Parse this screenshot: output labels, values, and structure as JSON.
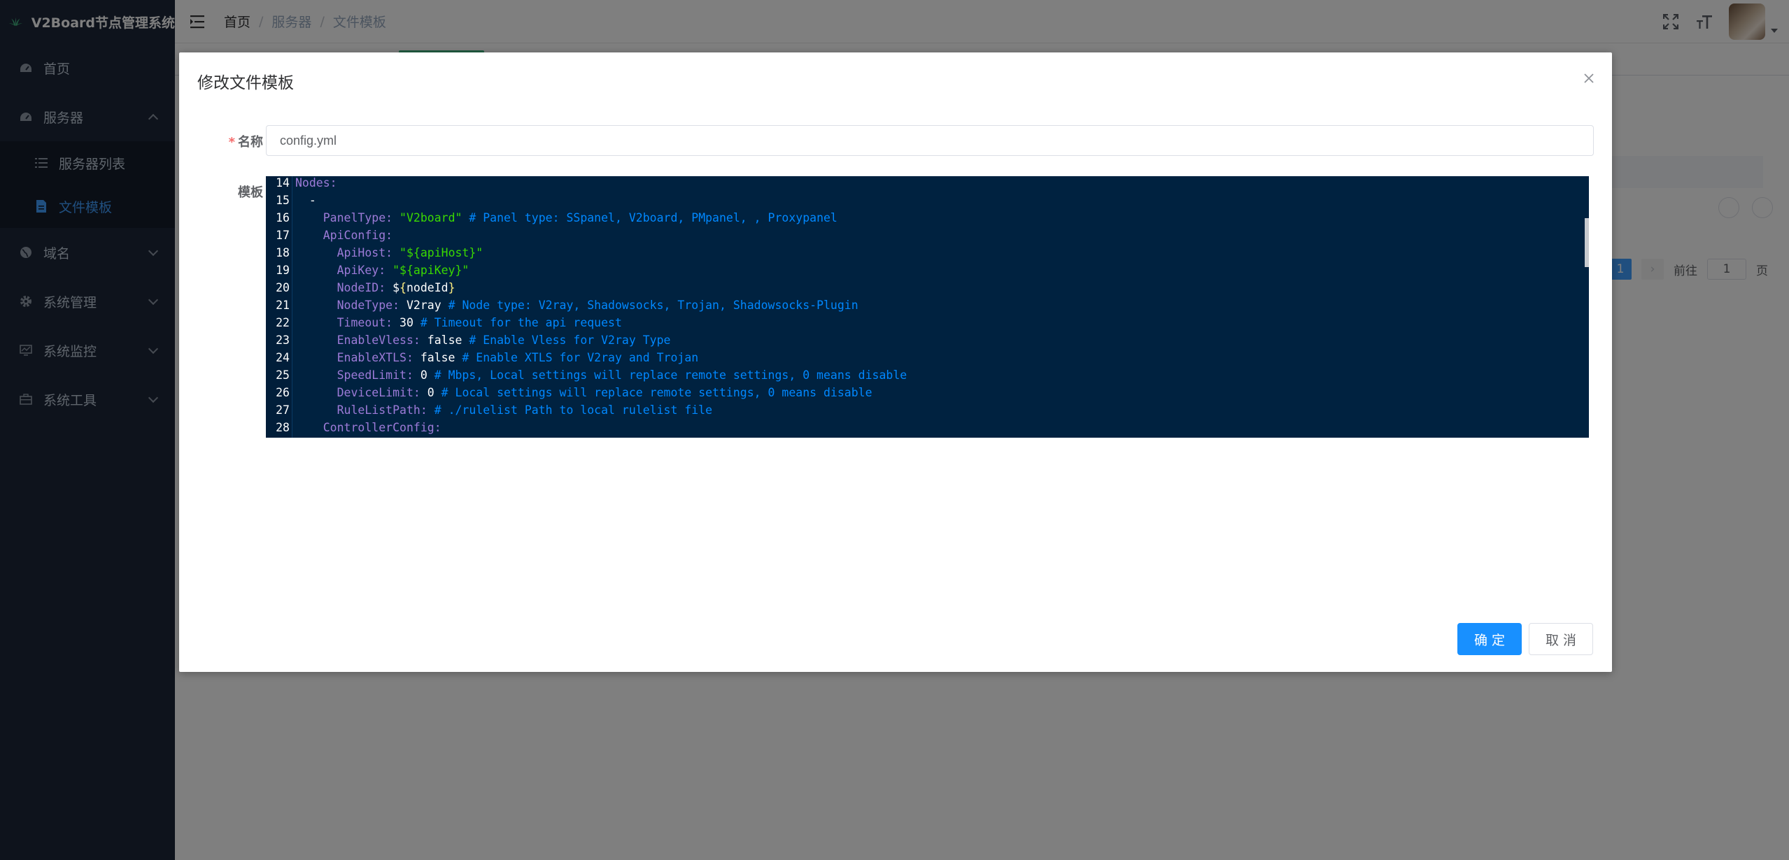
{
  "app": {
    "title": "V2Board节点管理系统"
  },
  "sidebar": {
    "items": [
      {
        "label": "首页",
        "icon": "dashboard-icon"
      },
      {
        "label": "服务器",
        "icon": "server-icon",
        "expanded": true,
        "children": [
          {
            "label": "服务器列表",
            "icon": "list-icon"
          },
          {
            "label": "文件模板",
            "icon": "document-icon",
            "active": true
          }
        ]
      },
      {
        "label": "域名",
        "icon": "globe-icon"
      },
      {
        "label": "系统管理",
        "icon": "gear-icon"
      },
      {
        "label": "系统监控",
        "icon": "monitor-icon"
      },
      {
        "label": "系统工具",
        "icon": "toolbox-icon"
      }
    ]
  },
  "header": {
    "breadcrumb": [
      "首页",
      "服务器",
      "文件模板"
    ]
  },
  "pagination": {
    "current_page": "1",
    "goto_label": "前往",
    "goto_value": "1",
    "page_suffix": "页"
  },
  "dialog": {
    "title": "修改文件模板",
    "name_label": "名称",
    "name_value": "config.yml",
    "template_label": "模板",
    "confirm_label": "确 定",
    "cancel_label": "取 消"
  },
  "editor": {
    "lines": [
      {
        "n": "14",
        "code": "Nodes:"
      },
      {
        "n": "15",
        "code": "  -"
      },
      {
        "n": "16",
        "code": "    PanelType: \"V2board\" # Panel type: SSpanel, V2board, PMpanel, , Proxypanel"
      },
      {
        "n": "17",
        "code": "    ApiConfig:"
      },
      {
        "n": "18",
        "code": "      ApiHost: \"${apiHost}\""
      },
      {
        "n": "19",
        "code": "      ApiKey: \"${apiKey}\""
      },
      {
        "n": "20",
        "code": "      NodeID: ${nodeId}"
      },
      {
        "n": "21",
        "code": "      NodeType: V2ray # Node type: V2ray, Shadowsocks, Trojan, Shadowsocks-Plugin"
      },
      {
        "n": "22",
        "code": "      Timeout: 30 # Timeout for the api request"
      },
      {
        "n": "23",
        "code": "      EnableVless: false # Enable Vless for V2ray Type"
      },
      {
        "n": "24",
        "code": "      EnableXTLS: false # Enable XTLS for V2ray and Trojan"
      },
      {
        "n": "25",
        "code": "      SpeedLimit: 0 # Mbps, Local settings will replace remote settings, 0 means disable"
      },
      {
        "n": "26",
        "code": "      DeviceLimit: 0 # Local settings will replace remote settings, 0 means disable"
      },
      {
        "n": "27",
        "code": "      RuleListPath: # ./rulelist Path to local rulelist file"
      },
      {
        "n": "28",
        "code": "    ControllerConfig:"
      }
    ]
  },
  "colors": {
    "sidebar_bg": "#1d2738",
    "active_menu": "#409eff",
    "primary_button": "#1890ff",
    "editor_bg": "#002240",
    "editor_key": "#9d7bd8",
    "editor_string": "#3ad900",
    "editor_comment": "#0088ff"
  }
}
